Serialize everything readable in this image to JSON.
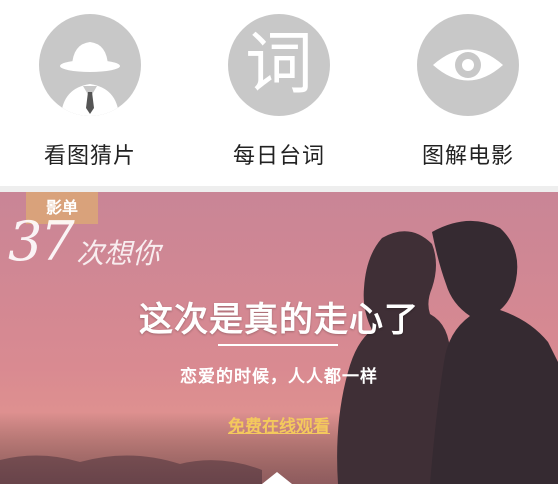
{
  "nav": {
    "items": [
      {
        "label": "看图猜片",
        "icon": "detective-hat-icon"
      },
      {
        "label": "每日台词",
        "icon": "quote-character-icon",
        "glyph": "词"
      },
      {
        "label": "图解电影",
        "icon": "eye-icon"
      }
    ]
  },
  "banner": {
    "tag": "影单",
    "poster_title": "37",
    "poster_subtitle": "次想你",
    "headline": "这次是真的走心了",
    "subtitle": "恋爱的时候，人人都一样",
    "cta": "免费在线观看"
  },
  "colors": {
    "icon_bg": "#c8c8c8",
    "tag_bg": "#d9a27b",
    "cta": "#f4c95d",
    "banner_sky_top": "#c98596",
    "banner_sky_bottom": "#e8928e"
  }
}
